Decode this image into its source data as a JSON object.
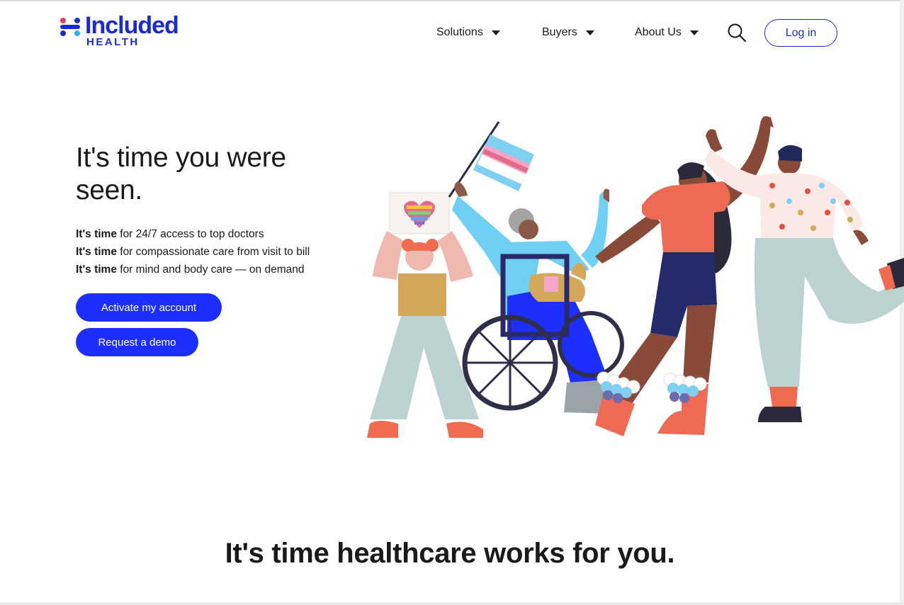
{
  "header": {
    "logo": {
      "word": "Included",
      "sub": "HEALTH",
      "brand_color": "#1a2bd6",
      "accent_colors": [
        "#f03c5a",
        "#27b3f0",
        "#1a2bd6"
      ]
    },
    "nav": [
      {
        "label": "Solutions"
      },
      {
        "label": "Buyers"
      },
      {
        "label": "About Us"
      }
    ],
    "search_icon": "search-icon",
    "login_label": "Log in"
  },
  "hero": {
    "title": "It's time you were seen.",
    "bullets": [
      {
        "bold": "It's time",
        "rest": " for 24/7 access to top doctors"
      },
      {
        "bold": "It's time",
        "rest": " for compassionate care from visit to bill"
      },
      {
        "bold": "It's time",
        "rest": " for mind and body care — on demand"
      }
    ],
    "activate_label": "Activate my account",
    "demo_label": "Request a demo",
    "button_color": "#1c2fff"
  },
  "section": {
    "title": "It's time healthcare works for you."
  }
}
